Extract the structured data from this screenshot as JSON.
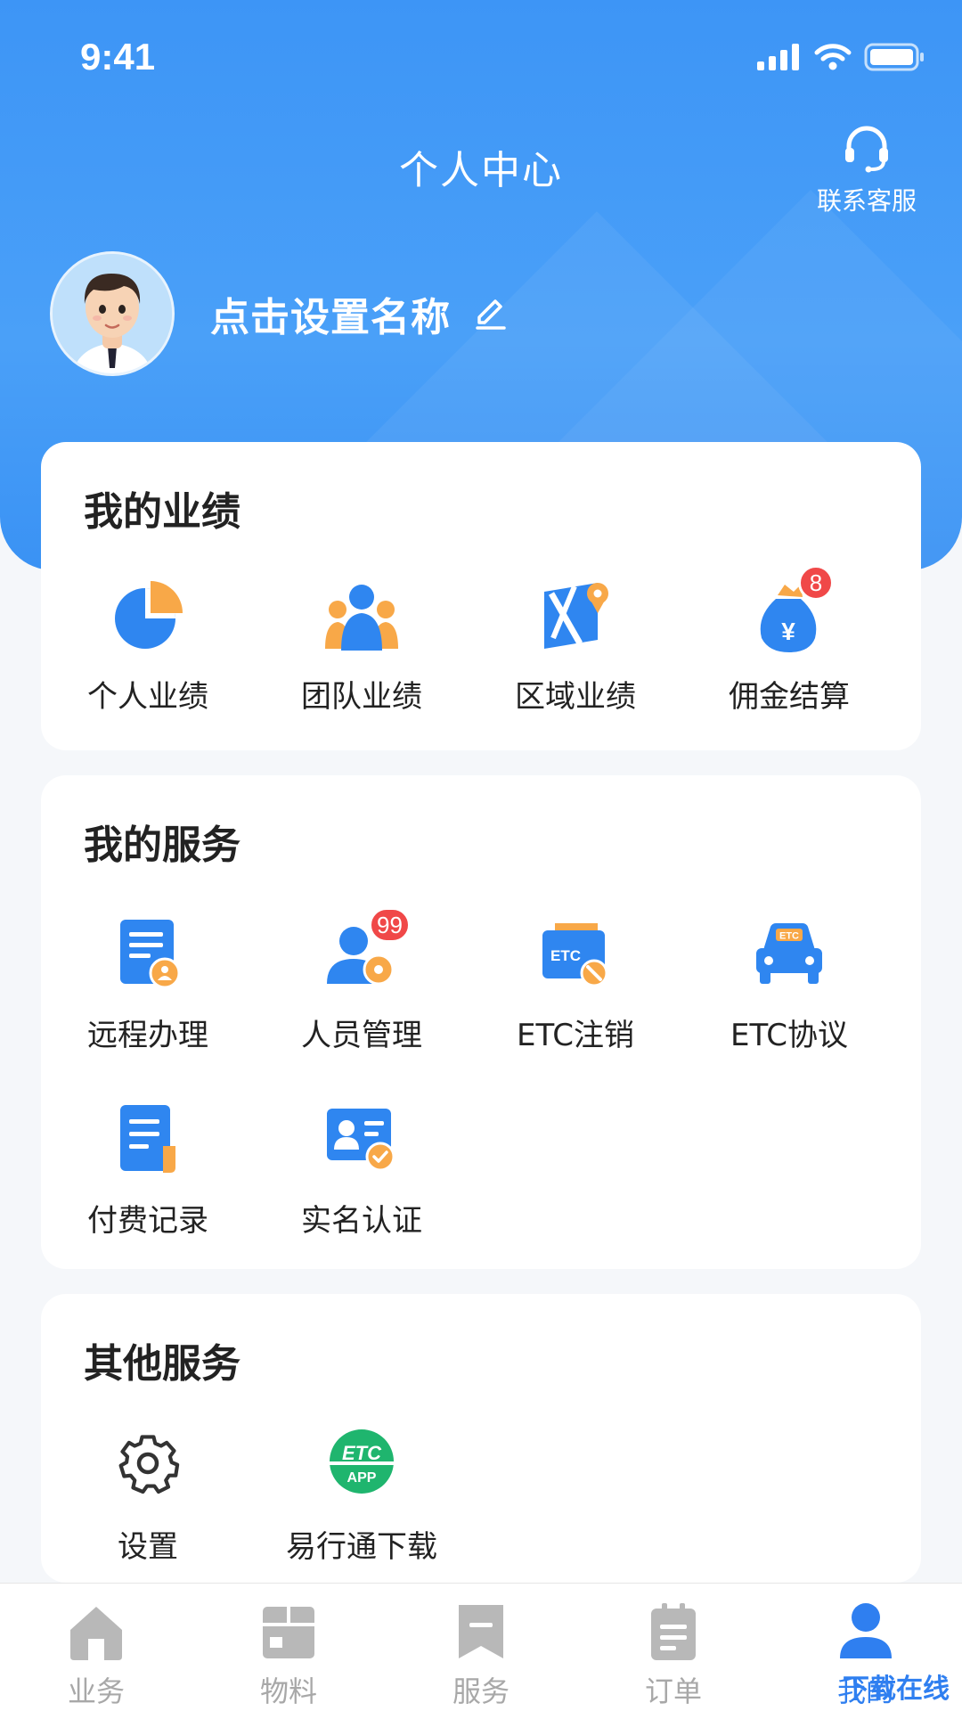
{
  "status_bar": {
    "time": "9:41"
  },
  "header": {
    "title": "个人中心",
    "customer_service_label": "联系客服",
    "profile_name": "点击设置名称"
  },
  "performance": {
    "title": "我的业绩",
    "items": [
      {
        "label": "个人业绩",
        "icon": "pie-chart-icon"
      },
      {
        "label": "团队业绩",
        "icon": "team-icon"
      },
      {
        "label": "区域业绩",
        "icon": "map-pin-icon"
      },
      {
        "label": "佣金结算",
        "icon": "money-bag-icon",
        "badge": "8"
      }
    ]
  },
  "services": {
    "title": "我的服务",
    "items": [
      {
        "label": "远程办理",
        "icon": "remote-document-icon"
      },
      {
        "label": "人员管理",
        "icon": "staff-management-icon",
        "badge": "99"
      },
      {
        "label": "ETC注销",
        "icon": "etc-card-cancel-icon"
      },
      {
        "label": "ETC协议",
        "icon": "etc-car-icon"
      },
      {
        "label": "付费记录",
        "icon": "payment-record-icon"
      },
      {
        "label": "实名认证",
        "icon": "id-verify-icon"
      }
    ]
  },
  "other": {
    "title": "其他服务",
    "items": [
      {
        "label": "设置",
        "icon": "gear-icon"
      },
      {
        "label": "易行通下载",
        "icon": "etc-app-icon",
        "icon_text_top": "ETC",
        "icon_text_bottom": "APP"
      }
    ]
  },
  "tabbar": {
    "items": [
      {
        "label": "业务",
        "icon": "home-icon",
        "active": false
      },
      {
        "label": "物料",
        "icon": "box-icon",
        "active": false
      },
      {
        "label": "服务",
        "icon": "bookmark-icon",
        "active": false
      },
      {
        "label": "订单",
        "icon": "clipboard-icon",
        "active": false
      },
      {
        "label": "我的",
        "icon": "user-icon",
        "active": true
      }
    ]
  },
  "watermark": "下载在线",
  "colors": {
    "primary": "#3d95f6",
    "badge": "#f04848",
    "orange": "#f8a848",
    "green": "#1fb56e",
    "inactive": "#a8a8a8"
  }
}
